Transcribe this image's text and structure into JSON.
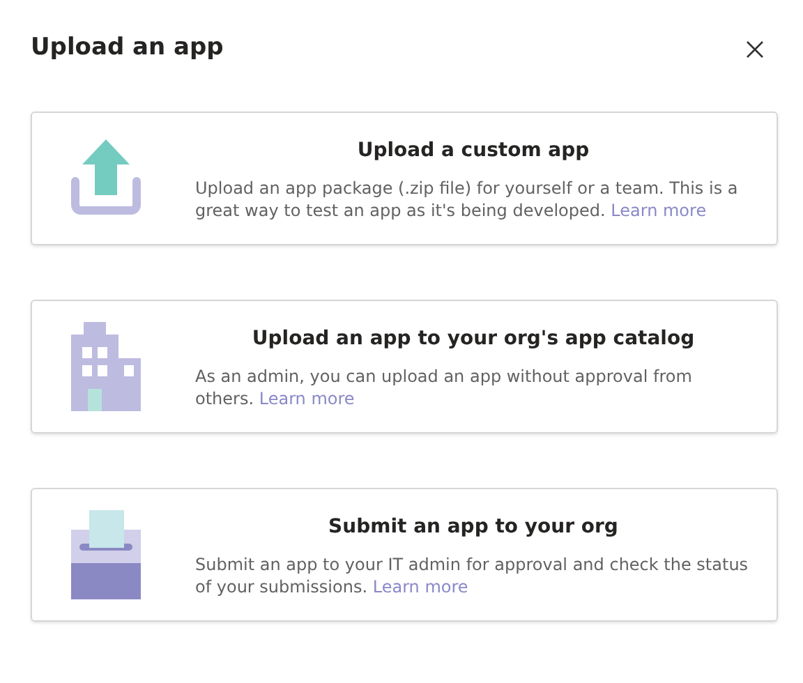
{
  "dialog": {
    "title": "Upload an app"
  },
  "options": [
    {
      "kind": "upload",
      "title": "Upload a custom app",
      "description": "Upload an app package (.zip file) for yourself or a team. This is a great way to test an app as it's being developed.",
      "link": "Learn more"
    },
    {
      "kind": "catalog",
      "title": "Upload an app to your org's app catalog",
      "description": "As an admin, you can upload an app without approval from others.",
      "link": "Learn more"
    },
    {
      "kind": "submit",
      "title": "Submit an app to your org",
      "description": "Submit an app to your IT admin for approval and check the status of your submissions.",
      "link": "Learn more"
    }
  ]
}
